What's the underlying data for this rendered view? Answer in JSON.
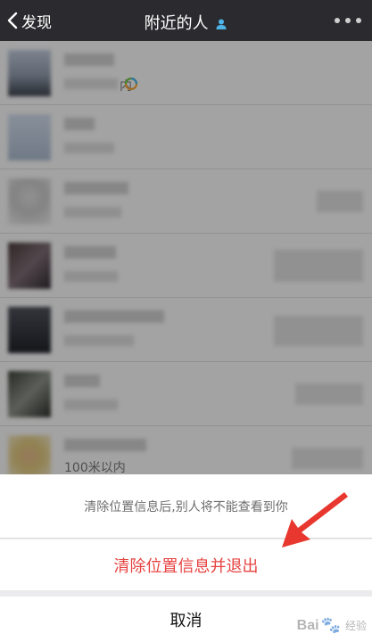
{
  "navbar": {
    "back_label": "发现",
    "title": "附近的人"
  },
  "nearby_rows": [
    {
      "distance_visible": "内"
    },
    {},
    {},
    {},
    {},
    {},
    {
      "distance_visible": "100米以内"
    }
  ],
  "action_sheet": {
    "tip": "清除位置信息后,别人将不能查看到你",
    "danger_label": "清除位置信息并退出",
    "cancel_label": "取消"
  },
  "watermark": {
    "brand": "Bai",
    "paw": "🐾",
    "suffix": "经验"
  },
  "colors": {
    "navbar_bg": "#2b2b2f",
    "danger": "#e64340",
    "annotation_arrow": "#e8372f"
  }
}
